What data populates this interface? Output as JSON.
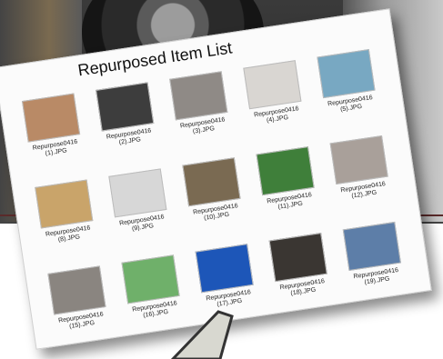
{
  "window": {
    "title": "Repurposed Item List",
    "folder_label": ""
  },
  "items": [
    {
      "line1": "Repurpose0416",
      "line2": "(1).JPG",
      "color": "#b98a66"
    },
    {
      "line1": "Repurpose0416",
      "line2": "(2).JPG",
      "color": "#3d3d3d"
    },
    {
      "line1": "Repurpose0416",
      "line2": "(3).JPG",
      "color": "#8f8a86"
    },
    {
      "line1": "Repurpose0416",
      "line2": "(4).JPG",
      "color": "#d9d6d2"
    },
    {
      "line1": "Repurpose0416",
      "line2": "(5).JPG",
      "color": "#78a8c2"
    },
    {
      "line1": "Repurpose0416",
      "line2": "(8).JPG",
      "color": "#c9a46a"
    },
    {
      "line1": "Repurpose0416",
      "line2": "(9).JPG",
      "color": "#d7d7d7"
    },
    {
      "line1": "Repurpose0416",
      "line2": "(10).JPG",
      "color": "#7a6a52"
    },
    {
      "line1": "Repurpose0416",
      "line2": "(11).JPG",
      "color": "#3f7f3a"
    },
    {
      "line1": "Repurpose0416",
      "line2": "(12).JPG",
      "color": "#a9a09a"
    },
    {
      "line1": "Repurpose0416",
      "line2": "(15).JPG",
      "color": "#8a8580"
    },
    {
      "line1": "Repurpose0416",
      "line2": "(16).JPG",
      "color": "#6fb06a"
    },
    {
      "line1": "Repurpose0416",
      "line2": "(17).JPG",
      "color": "#1d56b8"
    },
    {
      "line1": "Repurpose0416",
      "line2": "(18).JPG",
      "color": "#3a3632"
    },
    {
      "line1": "Repurpose0416",
      "line2": "(19).JPG",
      "color": "#5d7ea8"
    }
  ]
}
